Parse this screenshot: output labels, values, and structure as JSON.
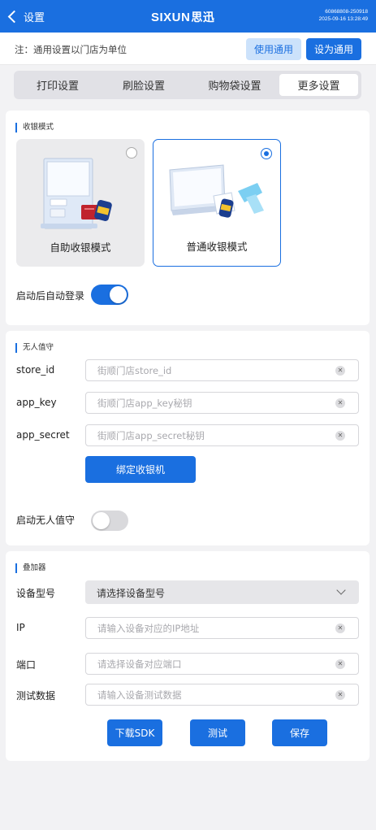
{
  "header": {
    "back_label": "设置",
    "logo_text": "SIXUN",
    "logo_cn": "思迅",
    "device_code": "60868808-250918",
    "datetime": "2025-09-16 13:28:49",
    "colors": {
      "primary": "#1a6fe0",
      "light": "#cce2fb"
    }
  },
  "notice": {
    "text": "注：通用设置以门店为单位",
    "use_common_label": "使用通用",
    "set_common_label": "设为通用"
  },
  "tabs": [
    {
      "label": "打印设置",
      "active": false
    },
    {
      "label": "刷脸设置",
      "active": false
    },
    {
      "label": "购物袋设置",
      "active": false
    },
    {
      "label": "更多设置",
      "active": true
    }
  ],
  "cashier_mode": {
    "title": "收银模式",
    "options": [
      {
        "label": "自助收银模式",
        "selected": false,
        "icon": "self-service-kiosk-icon"
      },
      {
        "label": "普通收银模式",
        "selected": true,
        "icon": "pos-terminal-icon"
      }
    ],
    "auto_login": {
      "label": "启动后自动登录",
      "on": true
    }
  },
  "unattended": {
    "title": "无人值守",
    "fields": [
      {
        "label": "store_id",
        "placeholder": "街顺门店store_id",
        "value": ""
      },
      {
        "label": "app_key",
        "placeholder": "街顺门店app_key秘钥",
        "value": ""
      },
      {
        "label": "app_secret",
        "placeholder": "街顺门店app_secret秘钥",
        "value": ""
      }
    ],
    "bind_label": "绑定收银机",
    "enable": {
      "label": "启动无人值守",
      "on": false
    }
  },
  "overlay": {
    "title": "叠加器",
    "device_model": {
      "label": "设备型号",
      "value": "请选择设备型号"
    },
    "fields": [
      {
        "label": "IP",
        "placeholder": "请输入设备对应的IP地址",
        "value": ""
      },
      {
        "label": "端口",
        "placeholder": "请选择设备对应端口",
        "value": ""
      },
      {
        "label": "测试数据",
        "placeholder": "请输入设备测试数据",
        "value": ""
      }
    ],
    "buttons": {
      "sdk": "下载SDK",
      "test": "测试",
      "save": "保存"
    }
  }
}
